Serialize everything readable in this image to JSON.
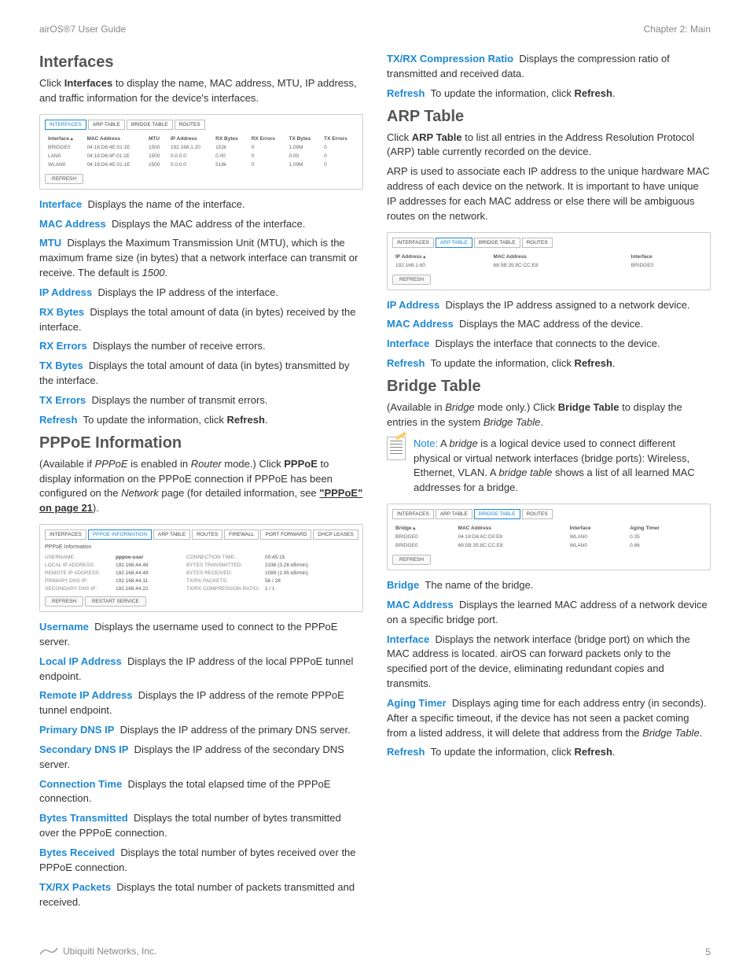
{
  "header": {
    "left": "airOS®7 User Guide",
    "right": "Chapter 2: Main"
  },
  "footer": {
    "company": "Ubiquiti Networks, Inc.",
    "page": "5"
  },
  "left": {
    "interfaces": {
      "heading": "Interfaces",
      "intro_pre": "Click ",
      "intro_bold": "Interfaces",
      "intro_post": " to display the name, MAC address, MTU, IP address, and traffic information for the device's interfaces.",
      "defs": {
        "interface": {
          "term": "Interface",
          "text": "Displays the name of the interface."
        },
        "mac": {
          "term": "MAC Address",
          "text": "Displays the MAC address of the interface."
        },
        "mtu": {
          "term": "MTU",
          "text_pre": "Displays the Maximum Transmission Unit (MTU), which is the maximum frame size (in bytes) that a network interface can transmit or receive. The default is ",
          "text_em": "1500",
          "text_post": "."
        },
        "ip": {
          "term": "IP Address",
          "text": "Displays the IP address of the interface."
        },
        "rxb": {
          "term": "RX Bytes",
          "text": "Displays the total amount of data (in bytes) received by the interface."
        },
        "rxe": {
          "term": "RX Errors",
          "text": "Displays the number of receive errors."
        },
        "txb": {
          "term": "TX Bytes",
          "text": "Displays the total amount of data (in bytes) transmitted by the interface."
        },
        "txe": {
          "term": "TX Errors",
          "text": "Displays the number of transmit errors."
        },
        "refresh": {
          "term": "Refresh",
          "text_pre": "To update the information, click ",
          "text_bold": "Refresh",
          "text_post": "."
        }
      },
      "screenshot": {
        "tabs": [
          "INTERFACES",
          "ARP TABLE",
          "BRIDGE TABLE",
          "ROUTES"
        ],
        "active_tab": 0,
        "headers": [
          "Interface",
          "MAC Address",
          "MTU",
          "IP Address",
          "RX Bytes",
          "RX Errors",
          "TX Bytes",
          "TX Errors"
        ],
        "rows": [
          [
            "BRIDGE0",
            "04:18:D6:4E:01:1E",
            "1500",
            "192.168.1.20",
            "152k",
            "0",
            "1.09M",
            "0"
          ],
          [
            "LAN0",
            "04:18:D6:4F:01:1E",
            "1500",
            "0.0.0.0",
            "0.00",
            "0",
            "0.00",
            "0"
          ],
          [
            "WLAN0",
            "04:18:D6:4E:01:1E",
            "1500",
            "0.0.0.0",
            "518k",
            "0",
            "1.09M",
            "0"
          ]
        ],
        "refresh_label": "REFRESH"
      }
    },
    "pppoe": {
      "heading": "PPPoE Information",
      "intro_pre": "(Available if ",
      "intro_em1": "PPPoE",
      "intro_mid1": " is enabled in ",
      "intro_em2": "Router",
      "intro_mid2": " mode.) Click ",
      "intro_bold": "PPPoE",
      "intro_mid3": " to display information on the PPPoE connection if PPPoE has been configured on the ",
      "intro_em3": "Network",
      "intro_mid4": " page (for detailed information, see ",
      "intro_link": "\"PPPoE\" on page 21",
      "intro_post": ").",
      "defs": {
        "username": {
          "term": "Username",
          "text": "Displays the username used to connect to the PPPoE server."
        },
        "localip": {
          "term": "Local IP Address",
          "text": "Displays the IP address of the local PPPoE tunnel endpoint."
        },
        "remoteip": {
          "term": "Remote IP Address",
          "text": "Displays the IP address of the remote PPPoE tunnel endpoint."
        },
        "pdns": {
          "term": "Primary DNS IP",
          "text": "Displays the IP address of the primary DNS server."
        },
        "sdns": {
          "term": "Secondary DNS IP",
          "text": "Displays the IP address of the secondary DNS server."
        },
        "conntime": {
          "term": "Connection Time",
          "text": "Displays the total elapsed time of the PPPoE connection."
        },
        "btx": {
          "term": "Bytes Transmitted",
          "text": "Displays the total number of bytes transmitted over the PPPoE connection."
        },
        "brx": {
          "term": "Bytes Received",
          "text": "Displays the total number of bytes received over the PPPoE connection."
        },
        "pkts": {
          "term": "TX/RX Packets",
          "text": "Displays the total number of packets transmitted and received."
        }
      },
      "screenshot": {
        "tabs": [
          "INTERFACES",
          "PPPOE INFORMATION",
          "ARP TABLE",
          "ROUTES",
          "FIREWALL",
          "PORT FORWARD",
          "DHCP LEASES"
        ],
        "active_tab": 1,
        "title": "PPPoE Information",
        "rows": [
          {
            "k1": "USERNAME:",
            "v1": "pppoe-user",
            "k2": "CONNECTION TIME:",
            "v2": "00:45:15"
          },
          {
            "k1": "LOCAL IP ADDRESS:",
            "v1": "192.168.44.48",
            "k2": "BYTES TRANSMITTED:",
            "v2": "2336 (3.26 kB/min)"
          },
          {
            "k1": "REMOTE IP ADDRESS:",
            "v1": "192.168.44.49",
            "k2": "BYTES RECEIVED:",
            "v2": "1089 (1.95 kB/min)"
          },
          {
            "k1": "PRIMARY DNS IP:",
            "v1": "192.168.44.11",
            "k2": "TX/RX PACKETS:",
            "v2": "56 / 28"
          },
          {
            "k1": "SECONDARY DNS IP:",
            "v1": "192.168.44.22",
            "k2": "TX/RX COMPRESSION RATIO:",
            "v2": "1 / 1"
          }
        ],
        "refresh_label": "REFRESH",
        "restart_label": "RESTART SERVICE"
      }
    }
  },
  "right": {
    "txrx": {
      "term": "TX/RX Compression Ratio",
      "text": "Displays the compression ratio of transmitted and received data."
    },
    "refresh1": {
      "term": "Refresh",
      "text_pre": "To update the information, click ",
      "text_bold": "Refresh",
      "text_post": "."
    },
    "arp": {
      "heading": "ARP Table",
      "intro_pre": "Click ",
      "intro_bold": "ARP Table",
      "intro_post": " to list all entries in the Address Resolution Protocol (ARP) table currently recorded on the device.",
      "para2": "ARP is used to associate each IP address to the unique hardware MAC address of each device on the network. It is important to have unique IP addresses for each MAC address or else there will be ambiguous routes on the network.",
      "defs": {
        "ip": {
          "term": "IP Address",
          "text": "Displays the IP address assigned to a network device."
        },
        "mac": {
          "term": "MAC Address",
          "text": "Displays the MAC address of the device."
        },
        "iface": {
          "term": "Interface",
          "text": "Displays the interface that connects to the device."
        },
        "refresh": {
          "term": "Refresh",
          "text_pre": "To update the information, click ",
          "text_bold": "Refresh",
          "text_post": "."
        }
      },
      "screenshot": {
        "tabs": [
          "INTERFACES",
          "ARP TABLE",
          "BRIDGE TABLE",
          "ROUTES"
        ],
        "active_tab": 1,
        "headers": [
          "IP Address",
          "MAC Address",
          "Interface"
        ],
        "rows": [
          [
            "192.168.1.60",
            "68:5B:35:8C:CC:E8",
            "BRIDGE0"
          ]
        ],
        "refresh_label": "REFRESH"
      }
    },
    "bridge": {
      "heading": "Bridge Table",
      "intro_pre": "(Available in ",
      "intro_em1": "Bridge",
      "intro_mid1": " mode only.) Click ",
      "intro_bold": "Bridge Table",
      "intro_mid2": " to display the entries in the system ",
      "intro_em2": "Bridge Table",
      "intro_post": ".",
      "note_label": "Note:",
      "note_pre": " A ",
      "note_em1": "bridge",
      "note_mid1": " is a logical device used to connect different physical or virtual network interfaces (bridge ports): Wireless, Ethernet, VLAN. A ",
      "note_em2": "bridge table",
      "note_post": " shows a list of all learned MAC addresses for a bridge.",
      "defs": {
        "bridge": {
          "term": "Bridge",
          "text": "The name of the bridge."
        },
        "mac": {
          "term": "MAC Address",
          "text": "Displays the learned MAC address of a network device on a specific bridge port."
        },
        "iface": {
          "term": "Interface",
          "text": "Displays the network interface (bridge port) on which the MAC address is located. airOS can forward packets only to the specified port of the device, eliminating redundant copies and transmits."
        },
        "aging": {
          "term": "Aging Timer",
          "text_pre": "Displays aging time for each address entry (in seconds). After a specific timeout, if the device has not seen a packet coming from a listed address, it will delete that address from the ",
          "text_em": "Bridge Table",
          "text_post": "."
        },
        "refresh": {
          "term": "Refresh",
          "text_pre": "To update the information, click ",
          "text_bold": "Refresh",
          "text_post": "."
        }
      },
      "screenshot": {
        "tabs": [
          "INTERFACES",
          "ARP TABLE",
          "BRIDGE TABLE",
          "ROUTES"
        ],
        "active_tab": 2,
        "headers": [
          "Bridge",
          "MAC Address",
          "Interface",
          "Aging Timer"
        ],
        "rows": [
          [
            "BRIDGE0",
            "04:18:D6:6C:D0:E8",
            "WLAN0",
            "0.35"
          ],
          [
            "BRIDGE0",
            "68:5B:35:8C:CC:E8",
            "WLAN0",
            "0.86"
          ]
        ],
        "refresh_label": "REFRESH"
      }
    }
  }
}
